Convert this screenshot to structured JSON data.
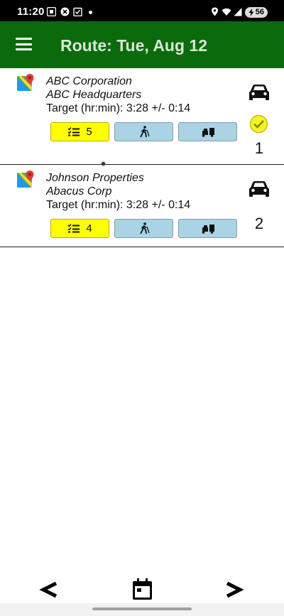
{
  "status_bar": {
    "time": "11:20",
    "battery_level": "56"
  },
  "header": {
    "title": "Route: Tue, Aug 12",
    "menu_icon": "hamburger-menu-icon",
    "bar_color": "#0a6b0a"
  },
  "routes": [
    {
      "company": "ABC Corporation",
      "location": "ABC Headquarters",
      "target": "Target (hr:min):  3:28 +/- 0:14",
      "task_count": "5",
      "stop_number": "1",
      "completed": true,
      "vehicle_icon": "car-icon",
      "map_icon": "google-maps-icon"
    },
    {
      "company": "Johnson Properties",
      "location": "Abacus Corp",
      "target": "Target (hr:min):  3:28 +/- 0:14",
      "task_count": "4",
      "stop_number": "2",
      "completed": false,
      "vehicle_icon": "car-icon",
      "map_icon": "google-maps-icon"
    }
  ],
  "buttons": {
    "tasks_icon": "checklist-icon",
    "walk_icon": "walking-person-icon",
    "deliver_icon": "delivery-truck-icon",
    "tasks_color": "#ffff00",
    "action_color": "#a8d4e6"
  },
  "bottom_nav": {
    "prev_label": "<",
    "next_label": ">",
    "calendar_icon": "calendar-icon"
  }
}
